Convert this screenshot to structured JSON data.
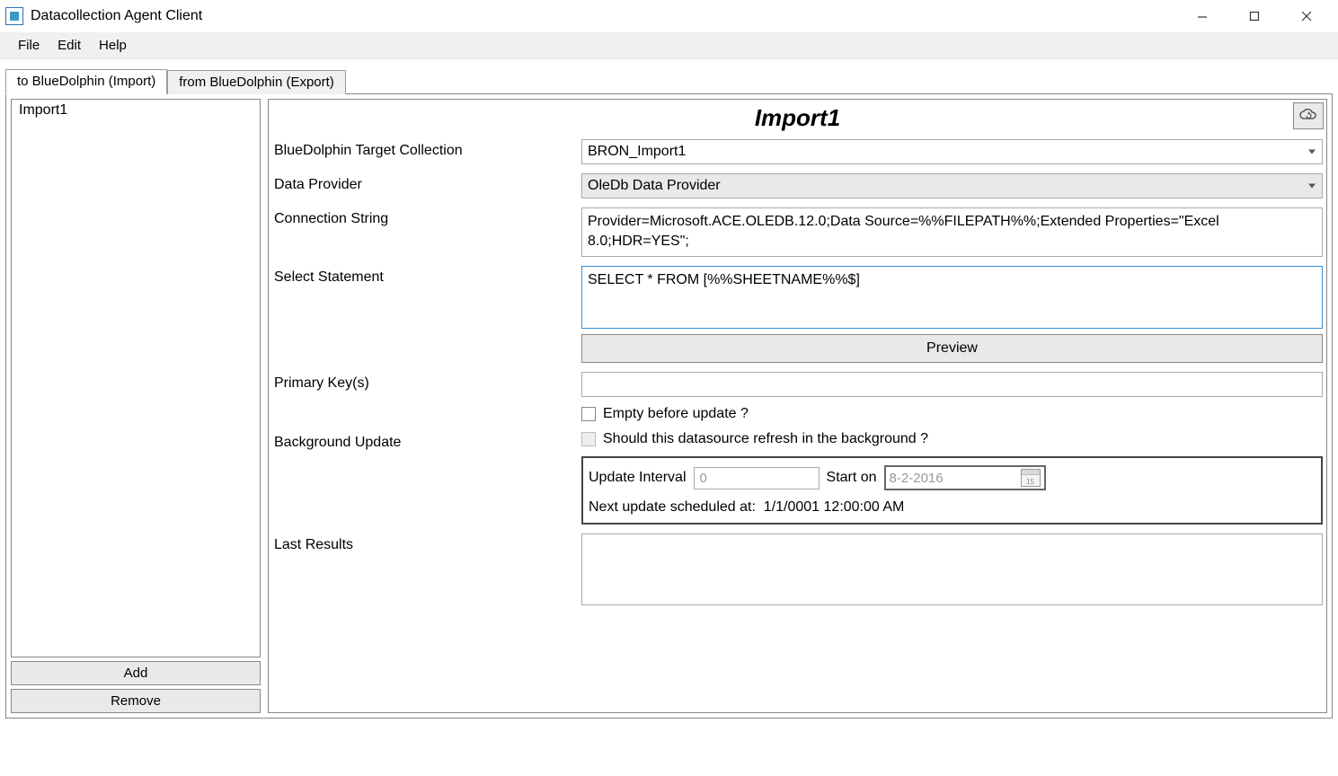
{
  "window": {
    "title": "Datacollection Agent Client"
  },
  "menu": {
    "file": "File",
    "edit": "Edit",
    "help": "Help"
  },
  "tabs": {
    "import": "to BlueDolphin (Import)",
    "export": "from BlueDolphin (Export)"
  },
  "sidebar": {
    "items": [
      "Import1"
    ],
    "add_label": "Add",
    "remove_label": "Remove"
  },
  "detail": {
    "title": "Import1",
    "labels": {
      "target": "BlueDolphin Target Collection",
      "provider": "Data Provider",
      "conn": "Connection String",
      "select": "Select Statement",
      "preview": "Preview",
      "pk": "Primary Key(s)",
      "empty_cb": "Empty before update ?",
      "bg": "Background Update",
      "bg_cb": "Should this datasource refresh in the background ?",
      "interval": "Update Interval",
      "start_on": "Start on",
      "next_update_prefix": "Next update scheduled at:",
      "last_results": "Last Results"
    },
    "values": {
      "target": "BRON_Import1",
      "provider": "OleDb Data Provider",
      "conn": "Provider=Microsoft.ACE.OLEDB.12.0;Data Source=%%FILEPATH%%;Extended Properties=\"Excel 8.0;HDR=YES\";",
      "select": "SELECT * FROM [%%SHEETNAME%%$]",
      "pk": "",
      "interval": "0",
      "start_date": "8-2-2016",
      "next_update": "1/1/0001 12:00:00 AM",
      "last_results": ""
    }
  }
}
